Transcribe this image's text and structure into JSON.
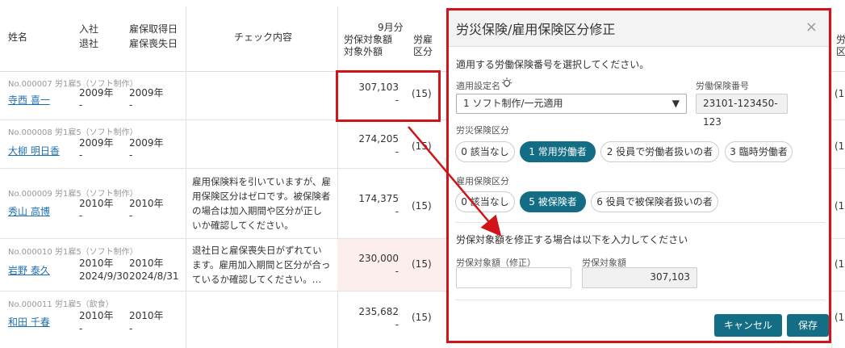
{
  "table": {
    "headers": {
      "name": "姓名",
      "join": "入社",
      "leave": "退社",
      "ins_get": "雇保取得日",
      "ins_lose": "雇保喪失日",
      "check": "チェック内容",
      "month": "9月分",
      "target": "労保対象額",
      "excluded": "対象外額",
      "emp_ins": "労雇",
      "kubun": "区分",
      "right_edge": "労",
      "right_edge2": "区"
    },
    "rows": [
      {
        "no": "No.000007 労1雇5（ソフト制作）",
        "name": "寺西 喜一",
        "join": "2009年",
        "leave": "-",
        "get": "2009年",
        "lose": "-",
        "note": "",
        "amount": "307,103",
        "excluded": "-",
        "kubun": "(15)",
        "right": "(15"
      },
      {
        "no": "No.000008 労1雇5（ソフト制作）",
        "name": "大柳 明日香",
        "join": "2009年",
        "leave": "-",
        "get": "2009年",
        "lose": "-",
        "note": "",
        "amount": "274,205",
        "excluded": "-",
        "kubun": "(15)",
        "right": "(15"
      },
      {
        "no": "No.000009 労1雇5（ソフト制作）",
        "name": "秀山 高博",
        "join": "2010年",
        "leave": "-",
        "get": "2010年",
        "lose": "-",
        "note": "雇用保険料を引いていますが、雇用保険区分はゼロです。被保険者の場合は加入期間や区分が正しいか確認してください。",
        "amount": "174,375",
        "excluded": "-",
        "kubun": "(15)",
        "right": "(15"
      },
      {
        "no": "No.000010 労1雇5（ソフト制作）",
        "name": "岩野 泰久",
        "join": "2010年",
        "leave": "2024/9/30",
        "get": "2010年",
        "lose": "2024/8/31",
        "note": "退社日と雇保喪失日がずれています。雇用加入期間と区分が合っているか確認してください。…",
        "amount": "230,000",
        "excluded": "-",
        "kubun": "(15)",
        "right": "(15"
      },
      {
        "no": "No.000011 労1雇5（飲食）",
        "name": "和田 千春",
        "join": "2010年",
        "leave": "-",
        "get": "2010年",
        "lose": "-",
        "note": "",
        "amount": "235,682",
        "excluded": "-",
        "kubun": "(15)",
        "right": "(15"
      }
    ]
  },
  "modal": {
    "title": "労災保険/雇用保険区分修正",
    "close": "×",
    "instruction": "適用する労働保険番号を選択してください。",
    "setting_label": "適用設定名",
    "setting_value": "1 ソフト制作/一元適用",
    "number_label": "労働保険番号",
    "number_value": "23101-123450-123",
    "rousai_label": "労災保険区分",
    "rousai_options": [
      "0 該当なし",
      "1 常用労働者",
      "2 役員で労働者扱いの者",
      "3 臨時労働者"
    ],
    "rousai_selected": 1,
    "koyou_label": "雇用保険区分",
    "koyou_options": [
      "0 該当なし",
      "5 被保険者",
      "6 役員で被保険者扱いの者"
    ],
    "koyou_selected": 1,
    "amount_instruction": "労保対象額を修正する場合は以下を入力してください",
    "corrected_label": "労保対象額（修正）",
    "corrected_value": "",
    "current_label": "労保対象額",
    "current_value": "307,103",
    "cancel": "キャンセル",
    "save": "保存"
  },
  "colors": {
    "accent": "#126d85",
    "highlight": "#d0141a",
    "link": "#1f6fb2",
    "pink_row": "#fdeeee"
  },
  "icons": {
    "bulb": "lightbulb-icon",
    "dropdown": "dropdown-arrow-icon"
  }
}
